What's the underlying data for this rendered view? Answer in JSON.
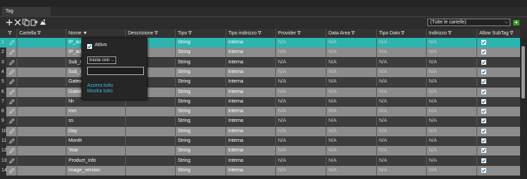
{
  "tab": {
    "label": "Tag"
  },
  "toolbar": {
    "icons": [
      "plus-icon",
      "delete-icon",
      "copy-icon",
      "export-icon",
      "import-icon"
    ],
    "folder_filter": "(Tutte le cartelle)",
    "add_label": "+"
  },
  "columns": [
    "",
    "Cartella",
    "Nome",
    "Descrizione",
    "Tipo",
    "Tipo indirizzo",
    "Provider",
    "Data Area",
    "Tipo Dato",
    "Indirizzo",
    "Allow SubTag"
  ],
  "column_sort_marks": [
    "∇",
    "∇",
    "▼",
    "∇",
    "∇",
    "∇",
    "∇",
    "∇",
    "∇",
    "∇",
    "∇"
  ],
  "rows": [
    {
      "num": "1",
      "nome": "IP_add",
      "tipo": "String",
      "indirizzo_tipo": "Interna",
      "provider": "N/A",
      "data_area": "N/A",
      "tipo_dato": "N/A",
      "indirizzo": "N/A",
      "allow_subtag": true,
      "selected": true
    },
    {
      "num": "2",
      "nome": "IP_add",
      "tipo": "String",
      "indirizzo_tipo": "Interna",
      "provider": "N/A",
      "data_area": "N/A",
      "tipo_dato": "N/A",
      "indirizzo": "N/A",
      "allow_subtag": true
    },
    {
      "num": "3",
      "nome": "Sub_m",
      "tipo": "String",
      "indirizzo_tipo": "Interna",
      "provider": "N/A",
      "data_area": "N/A",
      "tipo_dato": "N/A",
      "indirizzo": "N/A",
      "allow_subtag": true
    },
    {
      "num": "4",
      "nome": "Sub_m",
      "tipo": "String",
      "indirizzo_tipo": "Interna",
      "provider": "N/A",
      "data_area": "N/A",
      "tipo_dato": "N/A",
      "indirizzo": "N/A",
      "allow_subtag": true
    },
    {
      "num": "5",
      "nome": "Gatew",
      "tipo": "String",
      "indirizzo_tipo": "Interna",
      "provider": "N/A",
      "data_area": "N/A",
      "tipo_dato": "N/A",
      "indirizzo": "N/A",
      "allow_subtag": true
    },
    {
      "num": "6",
      "nome": "Gatew",
      "tipo": "String",
      "indirizzo_tipo": "Interna",
      "provider": "N/A",
      "data_area": "N/A",
      "tipo_dato": "N/A",
      "indirizzo": "N/A",
      "allow_subtag": true
    },
    {
      "num": "7",
      "nome": "hh",
      "tipo": "String",
      "indirizzo_tipo": "Interna",
      "provider": "N/A",
      "data_area": "N/A",
      "tipo_dato": "N/A",
      "indirizzo": "N/A",
      "allow_subtag": true
    },
    {
      "num": "8",
      "nome": "mm",
      "tipo": "String",
      "indirizzo_tipo": "Interna",
      "provider": "N/A",
      "data_area": "N/A",
      "tipo_dato": "N/A",
      "indirizzo": "N/A",
      "allow_subtag": true
    },
    {
      "num": "9",
      "nome": "ss",
      "tipo": "String",
      "indirizzo_tipo": "Interna",
      "provider": "N/A",
      "data_area": "N/A",
      "tipo_dato": "N/A",
      "indirizzo": "N/A",
      "allow_subtag": true
    },
    {
      "num": "10",
      "nome": "Day",
      "tipo": "String",
      "indirizzo_tipo": "Interna",
      "provider": "N/A",
      "data_area": "N/A",
      "tipo_dato": "N/A",
      "indirizzo": "N/A",
      "allow_subtag": true
    },
    {
      "num": "11",
      "nome": "Month",
      "tipo": "String",
      "indirizzo_tipo": "Interna",
      "provider": "N/A",
      "data_area": "N/A",
      "tipo_dato": "N/A",
      "indirizzo": "N/A",
      "allow_subtag": true
    },
    {
      "num": "12",
      "nome": "Year",
      "tipo": "String",
      "indirizzo_tipo": "Interna",
      "provider": "N/A",
      "data_area": "N/A",
      "tipo_dato": "N/A",
      "indirizzo": "N/A",
      "allow_subtag": true
    },
    {
      "num": "13",
      "nome": "Product_Info",
      "tipo": "String",
      "indirizzo_tipo": "Interna",
      "provider": "N/A",
      "data_area": "N/A",
      "tipo_dato": "N/A",
      "indirizzo": "N/A",
      "allow_subtag": true
    },
    {
      "num": "14",
      "nome": "Image_version",
      "tipo": "String",
      "indirizzo_tipo": "Interna",
      "provider": "N/A",
      "data_area": "N/A",
      "tipo_dato": "N/A",
      "indirizzo": "N/A",
      "allow_subtag": true
    }
  ],
  "filter_popup": {
    "active_label": "Attivo",
    "active_checked": true,
    "mode": "Inizia con",
    "filter_value": "",
    "clear_all": "Azzera tutto",
    "show_all": "Mostra tutto"
  },
  "colors": {
    "selected_row": "#2bb5b0",
    "odd_row": "#3c3c3c",
    "even_row": "#8c8c8c",
    "link": "#3fb9e0",
    "add_button": "#3a9a2a"
  }
}
